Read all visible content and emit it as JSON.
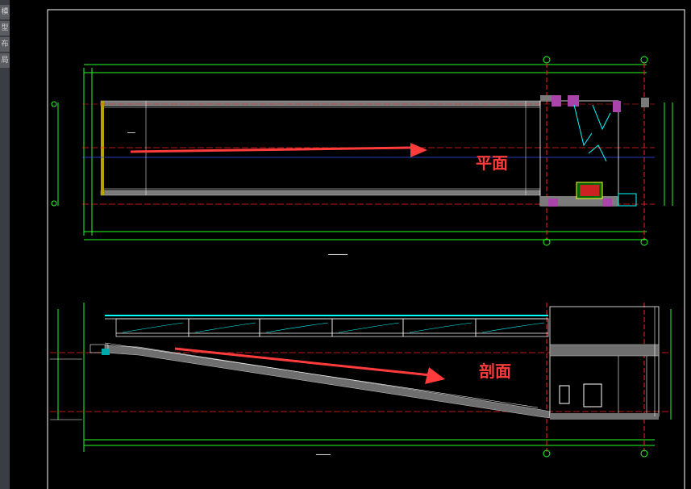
{
  "app": {
    "left_panel_tabs": [
      "模",
      "型",
      "布",
      "局"
    ]
  },
  "annotations": {
    "plan_label": "平面",
    "section_label": "剖面",
    "arrow_color": "#ff3b3b"
  },
  "colors": {
    "background": "#000000",
    "line_white": "#ffffff",
    "line_green": "#22ff22",
    "line_red": "#ff2020",
    "line_cyan": "#00ffff",
    "line_blue": "#3050ff",
    "line_magenta": "#ff30ff",
    "line_yellow": "#ffff30"
  }
}
